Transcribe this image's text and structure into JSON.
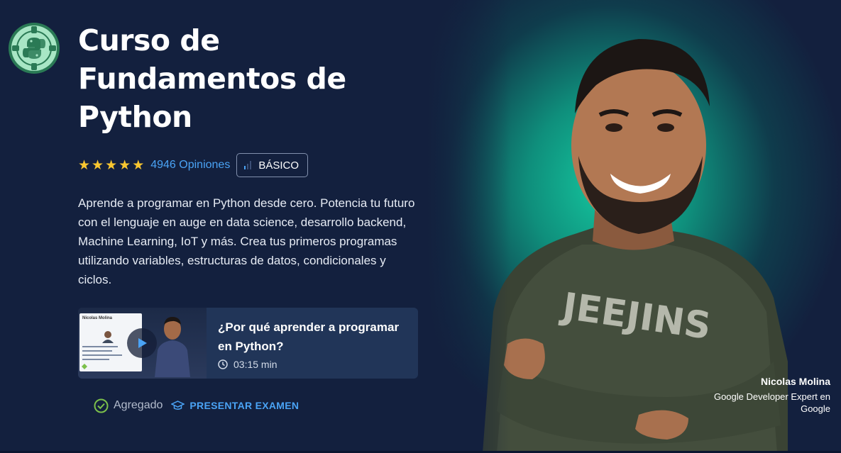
{
  "course": {
    "title_line1": "Curso de",
    "title_line2": "Fundamentos de",
    "title_line3": "Python",
    "badge_icon": "python-logo-icon",
    "rating_stars": 5,
    "opinions": "4946 Opiniones",
    "level": "BÁSICO",
    "description": "Aprende a programar en Python desde cero. Potencia tu futuro con el lenguaje en auge en data science, desarrollo backend, Machine Learning, IoT y más. Crea tus primeros programas utilizando variables, estructuras de datos, condicionales y ciclos."
  },
  "video": {
    "title": "¿Por qué aprender a programar en Python?",
    "duration": "03:15 min",
    "thumb_slide_title": "Nicolas Molina"
  },
  "actions": {
    "added_label": "Agregado",
    "exam_label": "PRESENTAR EXAMEN"
  },
  "teacher": {
    "name": "Nicolas Molina",
    "role": "Google Developer Expert en Google"
  },
  "colors": {
    "background": "#13203e",
    "accent_blue": "#4aa3f5",
    "star": "#f8c630",
    "teal": "#15c9a0",
    "check_green": "#7cc04b"
  }
}
